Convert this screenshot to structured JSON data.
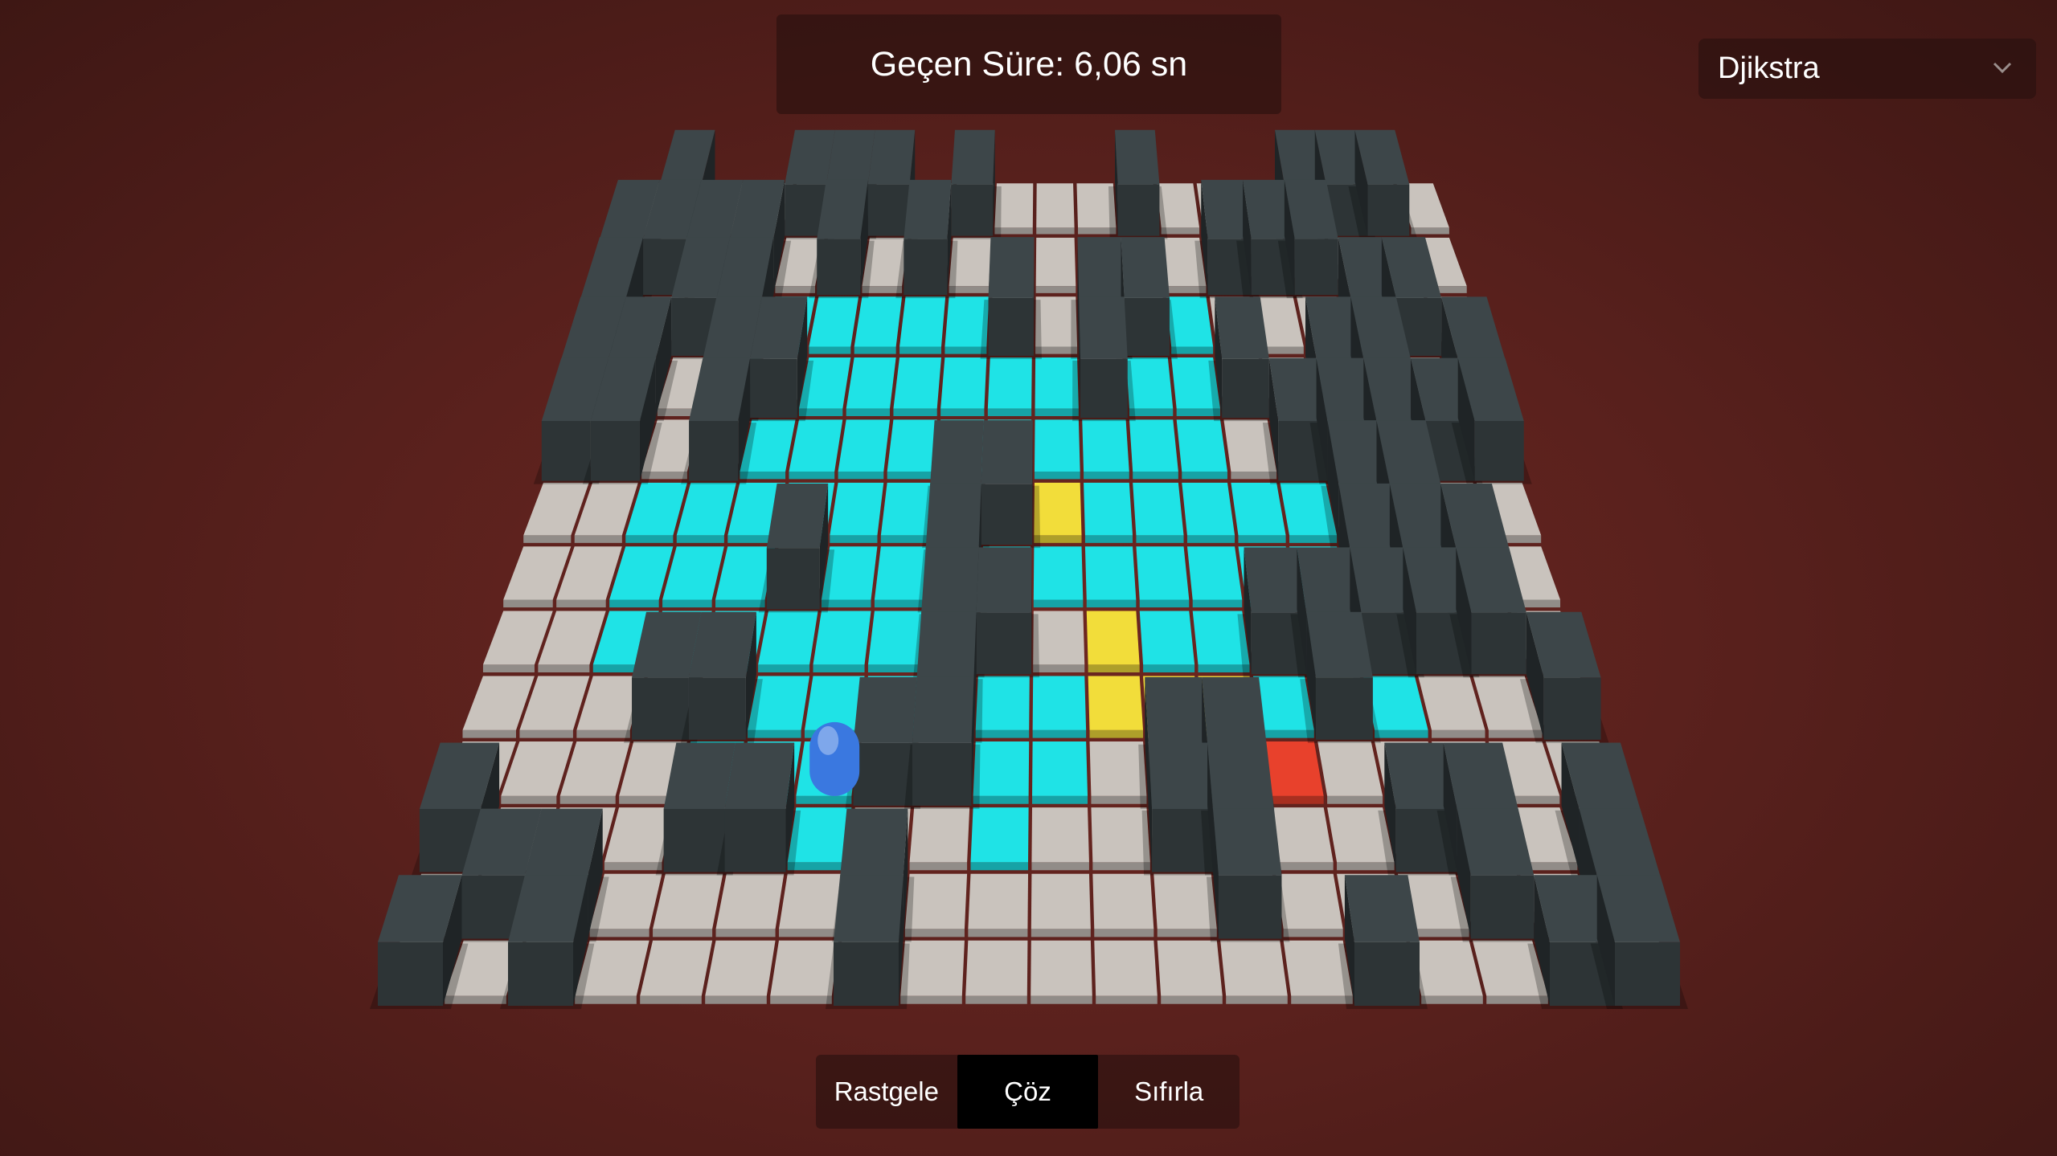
{
  "timer": {
    "text": "Geçen Süre: 6,06 sn"
  },
  "algorithm_select": {
    "selected": "Djikstra",
    "icon": "chevron-down-icon"
  },
  "buttons": [
    {
      "label": "Rastgele",
      "active": false
    },
    {
      "label": "Çöz",
      "active": true
    },
    {
      "label": "Sıfırla",
      "active": false
    }
  ],
  "board": {
    "cols": 20,
    "rows": 13,
    "legend": "0 floor, 1 wall, 2 visited, 3 path, 4 start, 5 goal",
    "cells": [
      "01001110100010001110",
      "11110101000000111000",
      "10112222210112000110",
      "11011222222122101101",
      "11012222222222011111",
      "00222222113222221100",
      "00222122122222221110",
      "00222222110322111110",
      "00011222122333212001",
      "00002221122011500000",
      "10001120020011001101",
      "01100001000001000101",
      "10100001000000010011"
    ],
    "colors": {
      "floor": "#c9c3bd",
      "wall": "#2d3436",
      "visited": "#1fe3e6",
      "path": "#f2dd3a",
      "start": "#3fcf4a",
      "goal": "#e8412c",
      "agent": "#3a78e0"
    },
    "agent_cell": [
      9,
      6
    ]
  }
}
